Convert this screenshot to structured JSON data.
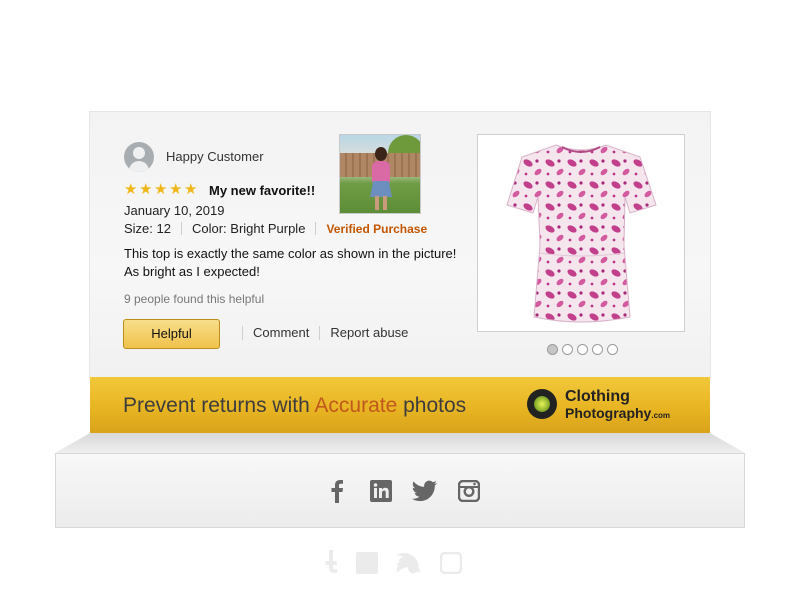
{
  "review": {
    "reviewer_name": "Happy Customer",
    "rating": 5,
    "title": "My new favorite!!",
    "date": "January 10, 2019",
    "size": "Size: 12",
    "color": "Color: Bright Purple",
    "verified": "Verified Purchase",
    "text": "This top is exactly the same color as shown in the picture! As bright as I expected!",
    "helpful_count": "9 people found this helpful",
    "helpful_button": "Helpful",
    "comment_link": "Comment",
    "report_link": "Report abuse"
  },
  "carousel": {
    "total": 5,
    "active": 1
  },
  "banner": {
    "tagline_before": "Prevent returns with ",
    "tagline_accent": "Accurate",
    "tagline_after": " photos",
    "logo_line1": "Clothing",
    "logo_line2": "Photography",
    "logo_tld": ".com"
  },
  "social": [
    "facebook-icon",
    "linkedin-icon",
    "twitter-icon",
    "instagram-icon"
  ],
  "colors": {
    "star": "#f0b71a",
    "verified": "#c45500",
    "accent": "#c0581e",
    "banner": "#e8b523",
    "button": "#f0c14b"
  }
}
